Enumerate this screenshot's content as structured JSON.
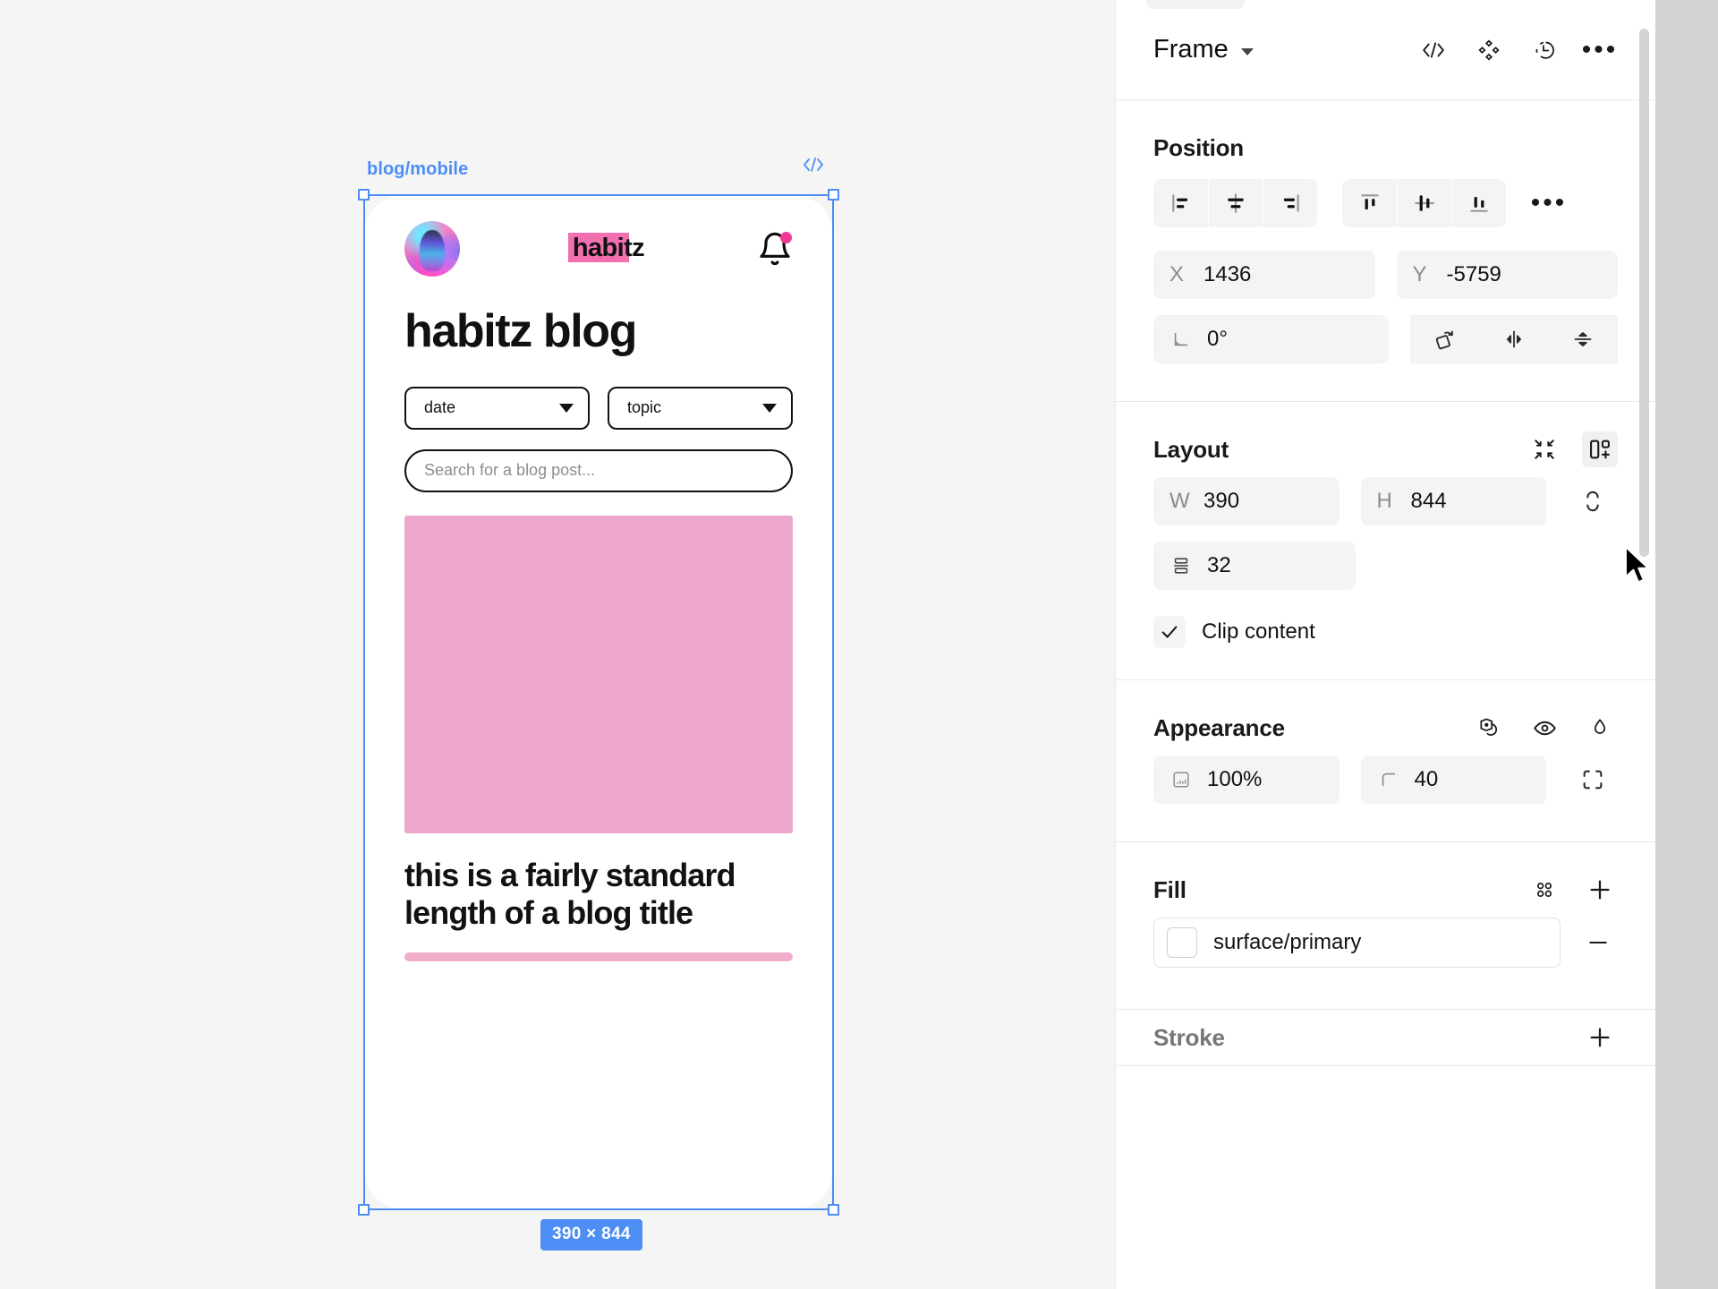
{
  "canvas": {
    "frame_label": "blog/mobile",
    "code_icon": "code-icon",
    "size_badge": "390 × 844"
  },
  "mockup": {
    "logo": "habitz",
    "page_heading": "habitz blog",
    "filters": [
      {
        "label": "date"
      },
      {
        "label": "topic"
      }
    ],
    "search_placeholder": "Search for a blog post...",
    "post_title": "this is a fairly standard length of a blog title",
    "colors": {
      "logo_highlight": "#f26fb0",
      "image_placeholder": "#eda6cc",
      "bell_dot": "#f0399b",
      "divider": "#f0aecb"
    }
  },
  "panel": {
    "node_type": "Frame",
    "header_icons": [
      "code-icon",
      "component-icon",
      "create-instance-icon",
      "more-options-icon"
    ],
    "position": {
      "title": "Position",
      "align_icons": [
        "align-left-icon",
        "align-horizontal-center-icon",
        "align-right-icon",
        "align-top-icon",
        "align-vertical-center-icon",
        "align-bottom-icon",
        "more-align-options-icon"
      ],
      "x_label": "X",
      "x_value": "1436",
      "y_label": "Y",
      "y_value": "-5759",
      "rotation_value": "0°",
      "transform_icons": [
        "rotate-icon",
        "flip-horizontal-icon",
        "flip-vertical-icon"
      ]
    },
    "layout": {
      "title": "Layout",
      "resize_to_fit_icon": "resize-to-fit-icon",
      "add_auto_layout_icon": "add-auto-layout-icon",
      "w_label": "W",
      "w_value": "390",
      "h_label": "H",
      "h_value": "844",
      "constraint_icon": "constraints-icon",
      "spacing_icon": "vertical-spacing-icon",
      "spacing_value": "32",
      "clip_label": "Clip content",
      "clip_checked": true
    },
    "appearance": {
      "title": "Appearance",
      "icons": [
        "blend-mode-icon",
        "visibility-icon",
        "opacity-icon"
      ],
      "opacity_value": "100%",
      "corner_radius_value": "40",
      "opacity_icon": "opacity-field-icon",
      "corner_icon": "corner-radius-icon",
      "individual_corners_icon": "individual-corners-icon"
    },
    "fill": {
      "title": "Fill",
      "style_icon": "style-picker-icon",
      "add_icon": "add-fill-icon",
      "item_name": "surface/primary",
      "item_color": "#ffffff",
      "remove_icon": "remove-fill-icon"
    },
    "stroke": {
      "title": "Stroke",
      "add_icon": "add-stroke-icon"
    }
  }
}
